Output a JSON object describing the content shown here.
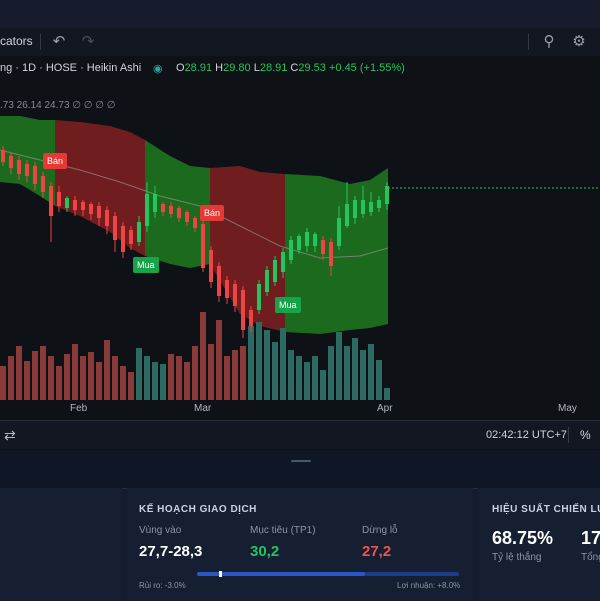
{
  "toolbar": {
    "indicators_label": "cators",
    "undo_icon": "undo-icon",
    "redo_icon": "redo-icon",
    "alert_icon": "alert-icon",
    "settings_icon": "settings-icon"
  },
  "legend": {
    "symbol": "ng · 1D · HOSE · Heikin Ashi",
    "open_k": "O",
    "open": "28.91",
    "high_k": "H",
    "high": "29.80",
    "low_k": "L",
    "low": "28.91",
    "close_k": "C",
    "close": "29.53",
    "change": "+0.45 (+1.55%)",
    "indicator_values": ".73   26.14  24.73   ∅  ∅  ∅  ∅"
  },
  "signals": [
    {
      "type": "sell",
      "label": "Bán"
    },
    {
      "type": "sell",
      "label": "Bán"
    },
    {
      "type": "buy",
      "label": "Mua"
    },
    {
      "type": "buy",
      "label": "Mua"
    }
  ],
  "xaxis": {
    "feb": "Feb",
    "mar": "Mar",
    "apr": "Apr",
    "may": "May"
  },
  "status": {
    "time": "02:42:12 UTC+7",
    "percent_toggle": "%"
  },
  "plan": {
    "title": "KẾ HOẠCH GIAO DỊCH",
    "entry_label": "Vùng vào",
    "entry_value": "27,7-28,3",
    "target_label": "Mục tiêu (TP1)",
    "target_value": "30,2",
    "stop_label": "Dừng lỗ",
    "stop_value": "27,2",
    "risk": "Rủi ro: -3.0%",
    "reward": "Lợi nhuận: +8.0%",
    "progress": 0.27
  },
  "performance": {
    "title": "HIỆU SUẤT CHIẾN LƯỢ",
    "winrate_value": "68.75%",
    "winrate_label": "Tỷ lệ thắng",
    "total_value": "17",
    "total_label": "Tổng"
  },
  "colors": {
    "up": "#22c55e",
    "down": "#ef4444",
    "target": "#22c55e",
    "stop": "#ef5350",
    "entry": "#ffffff"
  }
}
